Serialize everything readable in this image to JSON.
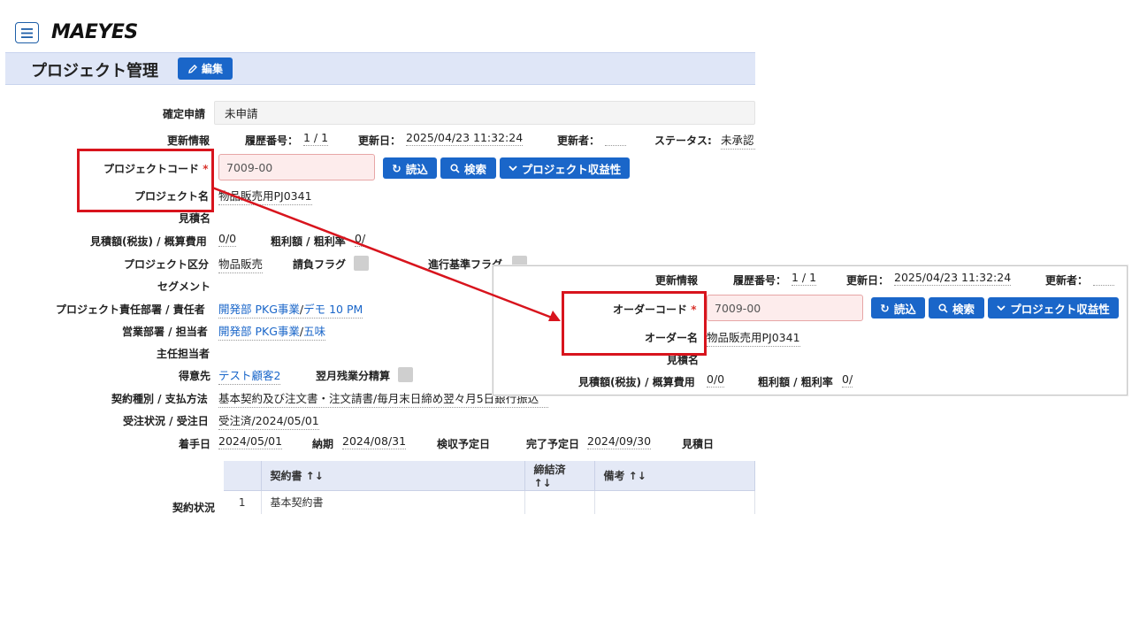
{
  "header": {
    "logo_text": "MAEYES",
    "page_title": "プロジェクト管理",
    "edit_label": "編集"
  },
  "form": {
    "confirm_apply": {
      "label": "確定申請",
      "value": "未申請"
    },
    "update_info": {
      "label": "更新情報",
      "rev_label": "履歴番号：",
      "rev_value": "1 / 1",
      "date_label": "更新日：",
      "date_value": "2025/04/23 11:32:24",
      "updater_label": "更新者：",
      "updater_value": "",
      "status_label": "ステータス:",
      "status_value": "未承認"
    },
    "project_code": {
      "label": "プロジェクトコード",
      "required_mark": "*",
      "value": "7009-00"
    },
    "buttons": {
      "load": "読込",
      "search": "検索",
      "profit": "プロジェクト収益性"
    },
    "project_name": {
      "label": "プロジェクト名",
      "value": "物品販売用PJ0341"
    },
    "estimate_name": {
      "label": "見積名",
      "value": ""
    },
    "estimate_amount": {
      "label": "見積額(税抜) / 概算費用",
      "value": "0/0"
    },
    "gross_profit": {
      "label": "粗利額 / 粗利率",
      "value": "0/"
    },
    "project_category": {
      "label": "プロジェクト区分",
      "value": "物品販売"
    },
    "contract_flag": {
      "label": "請負フラグ"
    },
    "progress_flag": {
      "label": "進行基準フラグ"
    },
    "segment": {
      "label": "セグメント",
      "value": ""
    },
    "responsible_dept": {
      "label": "プロジェクト責任部署 / 責任者",
      "dept": "開発部 PKG事業",
      "sep": "/",
      "person": "デモ 10 PM"
    },
    "sales_dept": {
      "label": "営業部署 / 担当者",
      "dept": "開発部 PKG事業",
      "sep": "/",
      "person": "五味"
    },
    "main_person": {
      "label": "主任担当者",
      "value": ""
    },
    "customer": {
      "label": "得意先",
      "value": "テスト顧客2"
    },
    "next_month_overtime": {
      "label": "翌月残業分精算"
    },
    "contract_type": {
      "label": "契約種別 / 支払方法",
      "value": "基本契約及び注文書・注文請書/毎月末日締め翌々月5日銀行振込"
    },
    "order_status": {
      "label": "受注状況 / 受注日",
      "value": "受注済/2024/05/01"
    },
    "start_date": {
      "label": "着手日",
      "value": "2024/05/01"
    },
    "deadline": {
      "label": "納期",
      "value": "2024/08/31"
    },
    "inspection_date": {
      "label": "検収予定日",
      "value": ""
    },
    "completion_date": {
      "label": "完了予定日",
      "value": "2024/09/30"
    },
    "estimate_date": {
      "label": "見積日",
      "value": ""
    }
  },
  "contract_table": {
    "label": "契約状況",
    "headers": [
      "",
      "契約書 ↑↓",
      "締結済 ↑↓",
      "備考 ↑↓"
    ],
    "rows": [
      [
        "1",
        "基本契約書",
        "",
        ""
      ]
    ]
  },
  "popup": {
    "update_info": {
      "label": "更新情報",
      "rev_label": "履歴番号：",
      "rev_value": "1 / 1",
      "date_label": "更新日：",
      "date_value": "2025/04/23 11:32:24",
      "updater_label": "更新者："
    },
    "order_code": {
      "label": "オーダーコード",
      "required_mark": "*",
      "value": "7009-00"
    },
    "buttons": {
      "load": "読込",
      "search": "検索",
      "profit": "プロジェクト収益性"
    },
    "order_name": {
      "label": "オーダー名",
      "value": "物品販売用PJ0341"
    },
    "estimate_name": {
      "label": "見積名"
    },
    "estimate_amount": {
      "label": "見積額(税抜) / 概算費用",
      "value": "0/0"
    },
    "gross_profit": {
      "label": "粗利額 / 粗利率",
      "value": "0/"
    }
  },
  "colors": {
    "accent": "#1a66c9",
    "highlight": "#d8141d",
    "title_bar": "#dfe6f7"
  }
}
